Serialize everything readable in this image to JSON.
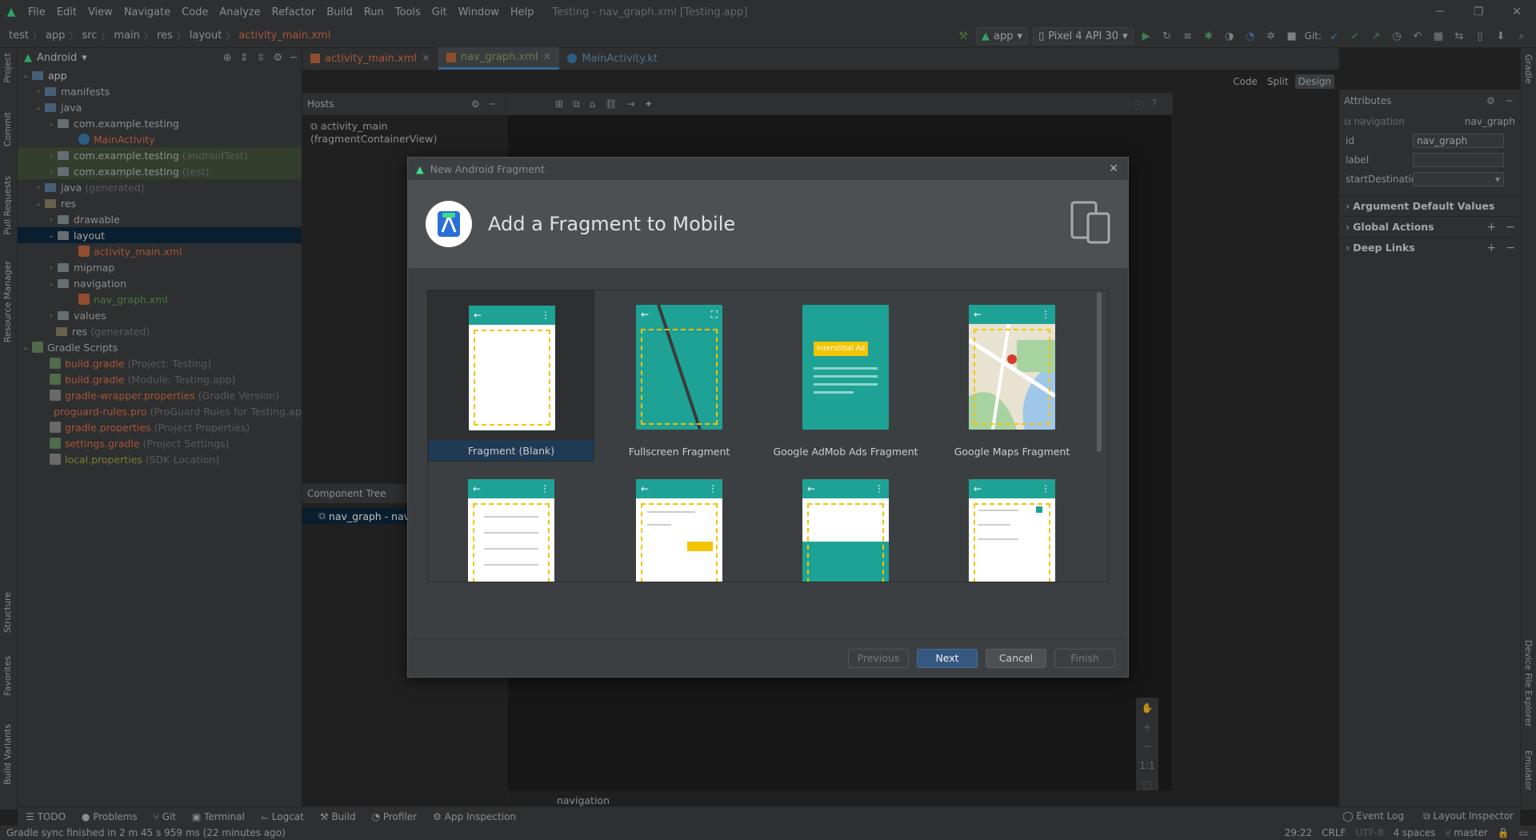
{
  "menu": [
    "File",
    "Edit",
    "View",
    "Navigate",
    "Code",
    "Analyze",
    "Refactor",
    "Build",
    "Run",
    "Tools",
    "Git",
    "Window",
    "Help"
  ],
  "window_title": "Testing - nav_graph.xml [Testing.app]",
  "breadcrumb": [
    "test",
    "app",
    "src",
    "main",
    "res",
    "layout",
    "activity_main.xml"
  ],
  "toolbar": {
    "run_config": "app",
    "device": "Pixel 4 API 30",
    "git_label": "Git:"
  },
  "left_tabs": [
    "Project",
    "Commit",
    "Pull Requests",
    "Resource Manager",
    "Structure",
    "Favorites",
    "Build Variants"
  ],
  "right_tabs": [
    "Gradle",
    "Device File Explorer",
    "Emulator"
  ],
  "project_panel": {
    "view": "Android",
    "tree": [
      {
        "label": "app",
        "extra": ""
      },
      {
        "label": "manifests",
        "extra": ""
      },
      {
        "label": "java",
        "extra": ""
      },
      {
        "label": "com.example.testing",
        "extra": ""
      },
      {
        "label": "MainActivity",
        "extra": ""
      },
      {
        "label": "com.example.testing",
        "extra": "(androidTest)"
      },
      {
        "label": "com.example.testing",
        "extra": "(test)"
      },
      {
        "label": "java",
        "extra": "(generated)"
      },
      {
        "label": "res",
        "extra": ""
      },
      {
        "label": "drawable",
        "extra": ""
      },
      {
        "label": "layout",
        "extra": ""
      },
      {
        "label": "activity_main.xml",
        "extra": ""
      },
      {
        "label": "mipmap",
        "extra": ""
      },
      {
        "label": "navigation",
        "extra": ""
      },
      {
        "label": "nav_graph.xml",
        "extra": ""
      },
      {
        "label": "values",
        "extra": ""
      },
      {
        "label": "res",
        "extra": "(generated)"
      },
      {
        "label": "Gradle Scripts",
        "extra": ""
      },
      {
        "label": "build.gradle",
        "extra": "(Project: Testing)"
      },
      {
        "label": "build.gradle",
        "extra": "(Module: Testing.app)"
      },
      {
        "label": "gradle-wrapper.properties",
        "extra": "(Gradle Version)"
      },
      {
        "label": "proguard-rules.pro",
        "extra": "(ProGuard Rules for Testing.app)"
      },
      {
        "label": "gradle.properties",
        "extra": "(Project Properties)"
      },
      {
        "label": "settings.gradle",
        "extra": "(Project Settings)"
      },
      {
        "label": "local.properties",
        "extra": "(SDK Location)"
      }
    ]
  },
  "editor_tabs": [
    "activity_main.xml",
    "nav_graph.xml",
    "MainActivity.kt"
  ],
  "view_switch": [
    "Code",
    "Split",
    "Design"
  ],
  "hosts": {
    "title": "Hosts",
    "item": "activity_main (fragmentContainerView)"
  },
  "component_tree": {
    "title": "Component Tree",
    "item": "nav_graph - nav"
  },
  "bottom_nav": "navigation",
  "attributes": {
    "title": "Attributes",
    "type": "navigation",
    "name": "nav_graph",
    "fields": [
      {
        "label": "id",
        "value": "nav_graph"
      },
      {
        "label": "label",
        "value": ""
      },
      {
        "label": "startDestination",
        "value": ""
      }
    ],
    "sections": [
      "Argument Default Values",
      "Global Actions",
      "Deep Links"
    ]
  },
  "dialog": {
    "title": "New Android Fragment",
    "heading": "Add a Fragment to Mobile",
    "templates": [
      "Fragment (Blank)",
      "Fullscreen Fragment",
      "Google AdMob Ads Fragment",
      "Google Maps Fragment",
      "",
      "",
      "",
      ""
    ],
    "ad_label": "Interstitial Ad",
    "buttons": {
      "previous": "Previous",
      "next": "Next",
      "cancel": "Cancel",
      "finish": "Finish"
    }
  },
  "tool_windows": [
    "TODO",
    "Problems",
    "Git",
    "Terminal",
    "Logcat",
    "Build",
    "Profiler",
    "App Inspection"
  ],
  "tool_windows_right": [
    "Event Log",
    "Layout Inspector"
  ],
  "status": {
    "message": "Gradle sync finished in 2 m 45 s 959 ms (22 minutes ago)",
    "position": "29:22",
    "line_sep": "CRLF",
    "encoding": "UTF-8",
    "indent": "4 spaces",
    "branch": "master"
  },
  "colors": {
    "accent": "#4a88c7",
    "template_teal": "#1fa296",
    "dashed": "#f3c400",
    "selection": "#0d293e"
  }
}
